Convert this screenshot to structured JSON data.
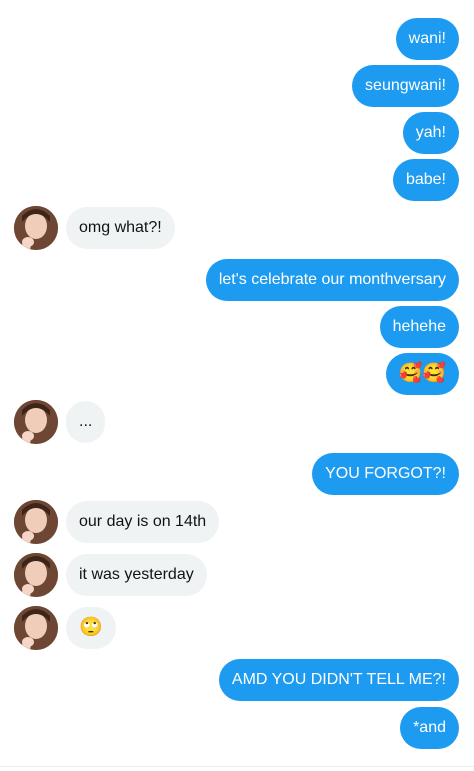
{
  "messages": [
    {
      "id": 1,
      "side": "sent",
      "text": "wani!"
    },
    {
      "id": 2,
      "side": "sent",
      "text": "seungwani!"
    },
    {
      "id": 3,
      "side": "sent",
      "text": "yah!"
    },
    {
      "id": 4,
      "side": "sent",
      "text": "babe!"
    },
    {
      "id": 5,
      "side": "received",
      "text": "omg what?!"
    },
    {
      "id": 6,
      "side": "sent",
      "text": "let's celebrate our monthversary"
    },
    {
      "id": 7,
      "side": "sent",
      "text": "hehehe"
    },
    {
      "id": 8,
      "side": "sent",
      "text": "🥰🥰"
    },
    {
      "id": 9,
      "side": "received",
      "text": "..."
    },
    {
      "id": 10,
      "side": "sent",
      "text": "YOU FORGOT?!"
    },
    {
      "id": 11,
      "side": "received",
      "text": "our day is on 14th"
    },
    {
      "id": 12,
      "side": "received",
      "text": "it was yesterday"
    },
    {
      "id": 13,
      "side": "received",
      "text": "🙄"
    },
    {
      "id": 14,
      "side": "sent",
      "text": "AMD YOU DIDN'T TELL ME?!"
    },
    {
      "id": 15,
      "side": "sent",
      "text": "*and"
    }
  ],
  "colors": {
    "sent_bubble": "#1d9bf0",
    "received_bubble": "#eff3f4",
    "sent_text": "#ffffff",
    "received_text": "#0f1419"
  }
}
